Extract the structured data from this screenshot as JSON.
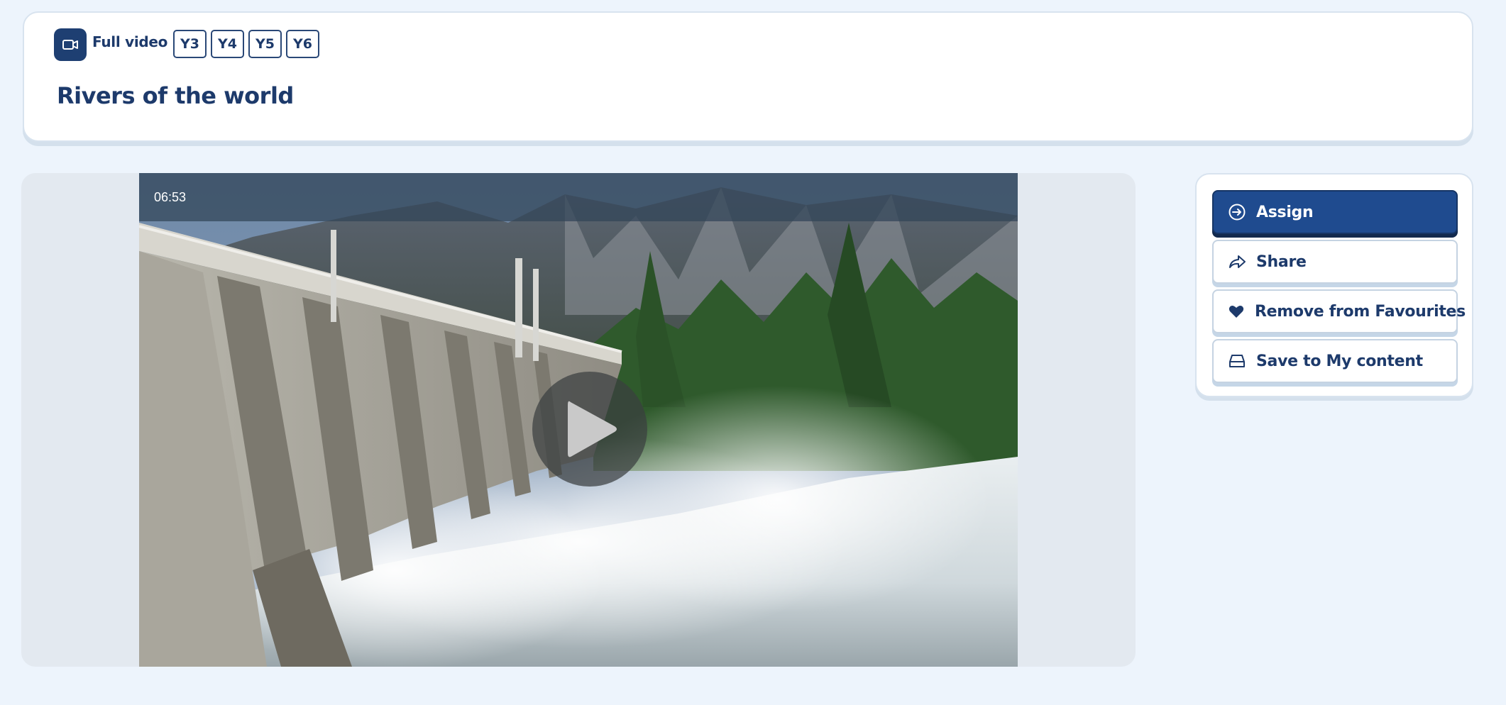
{
  "header": {
    "type_label": "Full video",
    "year_tags": [
      "Y3",
      "Y4",
      "Y5",
      "Y6"
    ],
    "title": "Rivers of the world"
  },
  "video": {
    "duration": "06:53"
  },
  "actions": {
    "assign": "Assign",
    "share": "Share",
    "favourites": "Remove from Favourites",
    "save": "Save to My content"
  },
  "icons": {
    "type_badge": "video-camera-icon",
    "assign": "arrow-circle-icon",
    "share": "share-arrow-icon",
    "favourites": "heart-icon",
    "save": "tray-icon",
    "play": "play-icon"
  },
  "colors": {
    "primary": "#1f4b8f",
    "text": "#1d3a6b",
    "background": "#edf4fc"
  }
}
